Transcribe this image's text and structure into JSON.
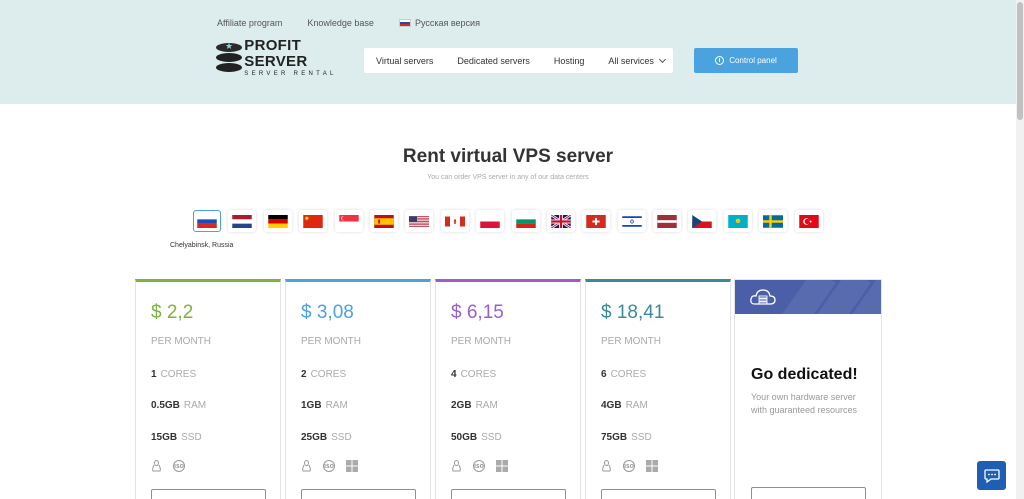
{
  "header": {
    "links": [
      "Affiliate program",
      "Knowledge base",
      "Русская версия"
    ],
    "logo": {
      "title": "PROFIT SERVER",
      "subtitle": "SERVER RENTAL"
    },
    "nav": [
      "Virtual servers",
      "Dedicated servers",
      "Hosting",
      "All services"
    ],
    "control_panel": "Control panel"
  },
  "main": {
    "title": "Rent virtual VPS server",
    "subtitle": "You can order VPS server in any of our data centers",
    "selected_location": "Chelyabinsk, Russia",
    "flags": [
      "russia",
      "netherlands",
      "germany",
      "china",
      "singapore",
      "spain",
      "usa",
      "canada",
      "poland",
      "bulgaria",
      "uk",
      "switzerland",
      "israel",
      "latvia",
      "czech",
      "kazakhstan",
      "sweden",
      "turkey"
    ]
  },
  "plans": [
    {
      "price": "$ 2,2",
      "period": "PER MONTH",
      "cores": "1",
      "cores_label": "CORES",
      "ram": "0.5GB",
      "ram_label": "RAM",
      "ssd": "15GB",
      "ssd_label": "SSD",
      "color": "#7cb342"
    },
    {
      "price": "$ 3,08",
      "period": "PER MONTH",
      "cores": "2",
      "cores_label": "CORES",
      "ram": "1GB",
      "ram_label": "RAM",
      "ssd": "25GB",
      "ssd_label": "SSD",
      "color": "#4aa3df"
    },
    {
      "price": "$ 6,15",
      "period": "PER MONTH",
      "cores": "4",
      "cores_label": "CORES",
      "ram": "2GB",
      "ram_label": "RAM",
      "ssd": "50GB",
      "ssd_label": "SSD",
      "color": "#9c5fc9"
    },
    {
      "price": "$ 18,41",
      "period": "PER MONTH",
      "cores": "6",
      "cores_label": "CORES",
      "ram": "4GB",
      "ram_label": "RAM",
      "ssd": "75GB",
      "ssd_label": "SSD",
      "color": "#3a8a9a"
    }
  ],
  "dedicated": {
    "title": "Go dedicated!",
    "text": "Your own hardware server with guaranteed resources"
  },
  "colors": {
    "header_bg": "#ddeded",
    "accent": "#4aa3df",
    "dedicated_banner": "#4a5fa8",
    "chat": "#1e5fb3"
  }
}
